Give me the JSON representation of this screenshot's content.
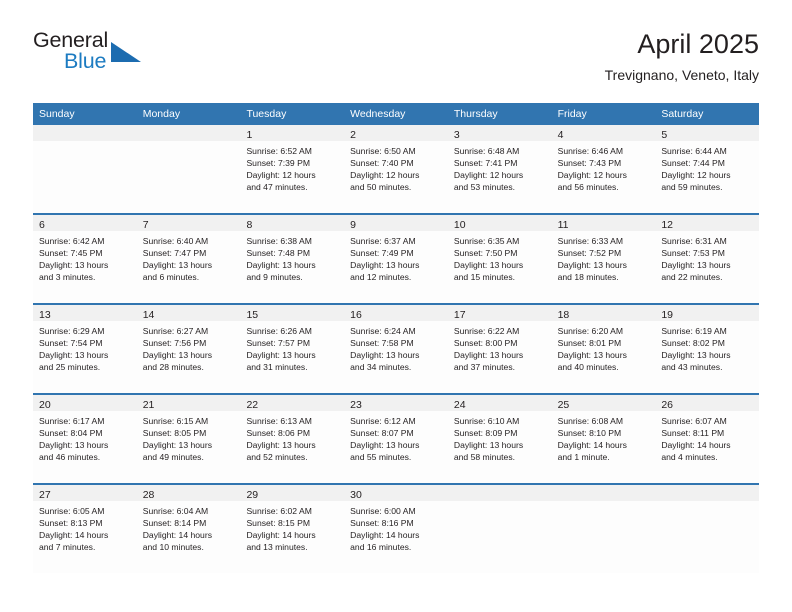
{
  "brand": {
    "name_top": "General",
    "name_bottom": "Blue",
    "triangle_icon": "triangle-icon",
    "color_text": "#231f20",
    "color_blue": "#1c7bc1",
    "color_triangle": "#1c6cb0"
  },
  "header": {
    "title": "April 2025",
    "subtitle": "Trevignano, Veneto, Italy"
  },
  "theme": {
    "header_blue": "#3175b0",
    "date_strip_grey": "#f1f1f1",
    "cell_white": "#fdfdfd",
    "text": "#231f20"
  },
  "weekdays": [
    "Sunday",
    "Monday",
    "Tuesday",
    "Wednesday",
    "Thursday",
    "Friday",
    "Saturday"
  ],
  "weeks": [
    [
      {
        "date": "",
        "empty": true,
        "sunrise": "",
        "sunset": "",
        "daylight_1": "",
        "daylight_2": ""
      },
      {
        "date": "",
        "empty": true,
        "sunrise": "",
        "sunset": "",
        "daylight_1": "",
        "daylight_2": ""
      },
      {
        "date": "1",
        "empty": false,
        "sunrise": "Sunrise: 6:52 AM",
        "sunset": "Sunset: 7:39 PM",
        "daylight_1": "Daylight: 12 hours",
        "daylight_2": "and 47 minutes."
      },
      {
        "date": "2",
        "empty": false,
        "sunrise": "Sunrise: 6:50 AM",
        "sunset": "Sunset: 7:40 PM",
        "daylight_1": "Daylight: 12 hours",
        "daylight_2": "and 50 minutes."
      },
      {
        "date": "3",
        "empty": false,
        "sunrise": "Sunrise: 6:48 AM",
        "sunset": "Sunset: 7:41 PM",
        "daylight_1": "Daylight: 12 hours",
        "daylight_2": "and 53 minutes."
      },
      {
        "date": "4",
        "empty": false,
        "sunrise": "Sunrise: 6:46 AM",
        "sunset": "Sunset: 7:43 PM",
        "daylight_1": "Daylight: 12 hours",
        "daylight_2": "and 56 minutes."
      },
      {
        "date": "5",
        "empty": false,
        "sunrise": "Sunrise: 6:44 AM",
        "sunset": "Sunset: 7:44 PM",
        "daylight_1": "Daylight: 12 hours",
        "daylight_2": "and 59 minutes."
      }
    ],
    [
      {
        "date": "6",
        "empty": false,
        "sunrise": "Sunrise: 6:42 AM",
        "sunset": "Sunset: 7:45 PM",
        "daylight_1": "Daylight: 13 hours",
        "daylight_2": "and 3 minutes."
      },
      {
        "date": "7",
        "empty": false,
        "sunrise": "Sunrise: 6:40 AM",
        "sunset": "Sunset: 7:47 PM",
        "daylight_1": "Daylight: 13 hours",
        "daylight_2": "and 6 minutes."
      },
      {
        "date": "8",
        "empty": false,
        "sunrise": "Sunrise: 6:38 AM",
        "sunset": "Sunset: 7:48 PM",
        "daylight_1": "Daylight: 13 hours",
        "daylight_2": "and 9 minutes."
      },
      {
        "date": "9",
        "empty": false,
        "sunrise": "Sunrise: 6:37 AM",
        "sunset": "Sunset: 7:49 PM",
        "daylight_1": "Daylight: 13 hours",
        "daylight_2": "and 12 minutes."
      },
      {
        "date": "10",
        "empty": false,
        "sunrise": "Sunrise: 6:35 AM",
        "sunset": "Sunset: 7:50 PM",
        "daylight_1": "Daylight: 13 hours",
        "daylight_2": "and 15 minutes."
      },
      {
        "date": "11",
        "empty": false,
        "sunrise": "Sunrise: 6:33 AM",
        "sunset": "Sunset: 7:52 PM",
        "daylight_1": "Daylight: 13 hours",
        "daylight_2": "and 18 minutes."
      },
      {
        "date": "12",
        "empty": false,
        "sunrise": "Sunrise: 6:31 AM",
        "sunset": "Sunset: 7:53 PM",
        "daylight_1": "Daylight: 13 hours",
        "daylight_2": "and 22 minutes."
      }
    ],
    [
      {
        "date": "13",
        "empty": false,
        "sunrise": "Sunrise: 6:29 AM",
        "sunset": "Sunset: 7:54 PM",
        "daylight_1": "Daylight: 13 hours",
        "daylight_2": "and 25 minutes."
      },
      {
        "date": "14",
        "empty": false,
        "sunrise": "Sunrise: 6:27 AM",
        "sunset": "Sunset: 7:56 PM",
        "daylight_1": "Daylight: 13 hours",
        "daylight_2": "and 28 minutes."
      },
      {
        "date": "15",
        "empty": false,
        "sunrise": "Sunrise: 6:26 AM",
        "sunset": "Sunset: 7:57 PM",
        "daylight_1": "Daylight: 13 hours",
        "daylight_2": "and 31 minutes."
      },
      {
        "date": "16",
        "empty": false,
        "sunrise": "Sunrise: 6:24 AM",
        "sunset": "Sunset: 7:58 PM",
        "daylight_1": "Daylight: 13 hours",
        "daylight_2": "and 34 minutes."
      },
      {
        "date": "17",
        "empty": false,
        "sunrise": "Sunrise: 6:22 AM",
        "sunset": "Sunset: 8:00 PM",
        "daylight_1": "Daylight: 13 hours",
        "daylight_2": "and 37 minutes."
      },
      {
        "date": "18",
        "empty": false,
        "sunrise": "Sunrise: 6:20 AM",
        "sunset": "Sunset: 8:01 PM",
        "daylight_1": "Daylight: 13 hours",
        "daylight_2": "and 40 minutes."
      },
      {
        "date": "19",
        "empty": false,
        "sunrise": "Sunrise: 6:19 AM",
        "sunset": "Sunset: 8:02 PM",
        "daylight_1": "Daylight: 13 hours",
        "daylight_2": "and 43 minutes."
      }
    ],
    [
      {
        "date": "20",
        "empty": false,
        "sunrise": "Sunrise: 6:17 AM",
        "sunset": "Sunset: 8:04 PM",
        "daylight_1": "Daylight: 13 hours",
        "daylight_2": "and 46 minutes."
      },
      {
        "date": "21",
        "empty": false,
        "sunrise": "Sunrise: 6:15 AM",
        "sunset": "Sunset: 8:05 PM",
        "daylight_1": "Daylight: 13 hours",
        "daylight_2": "and 49 minutes."
      },
      {
        "date": "22",
        "empty": false,
        "sunrise": "Sunrise: 6:13 AM",
        "sunset": "Sunset: 8:06 PM",
        "daylight_1": "Daylight: 13 hours",
        "daylight_2": "and 52 minutes."
      },
      {
        "date": "23",
        "empty": false,
        "sunrise": "Sunrise: 6:12 AM",
        "sunset": "Sunset: 8:07 PM",
        "daylight_1": "Daylight: 13 hours",
        "daylight_2": "and 55 minutes."
      },
      {
        "date": "24",
        "empty": false,
        "sunrise": "Sunrise: 6:10 AM",
        "sunset": "Sunset: 8:09 PM",
        "daylight_1": "Daylight: 13 hours",
        "daylight_2": "and 58 minutes."
      },
      {
        "date": "25",
        "empty": false,
        "sunrise": "Sunrise: 6:08 AM",
        "sunset": "Sunset: 8:10 PM",
        "daylight_1": "Daylight: 14 hours",
        "daylight_2": "and 1 minute."
      },
      {
        "date": "26",
        "empty": false,
        "sunrise": "Sunrise: 6:07 AM",
        "sunset": "Sunset: 8:11 PM",
        "daylight_1": "Daylight: 14 hours",
        "daylight_2": "and 4 minutes."
      }
    ],
    [
      {
        "date": "27",
        "empty": false,
        "sunrise": "Sunrise: 6:05 AM",
        "sunset": "Sunset: 8:13 PM",
        "daylight_1": "Daylight: 14 hours",
        "daylight_2": "and 7 minutes."
      },
      {
        "date": "28",
        "empty": false,
        "sunrise": "Sunrise: 6:04 AM",
        "sunset": "Sunset: 8:14 PM",
        "daylight_1": "Daylight: 14 hours",
        "daylight_2": "and 10 minutes."
      },
      {
        "date": "29",
        "empty": false,
        "sunrise": "Sunrise: 6:02 AM",
        "sunset": "Sunset: 8:15 PM",
        "daylight_1": "Daylight: 14 hours",
        "daylight_2": "and 13 minutes."
      },
      {
        "date": "30",
        "empty": false,
        "sunrise": "Sunrise: 6:00 AM",
        "sunset": "Sunset: 8:16 PM",
        "daylight_1": "Daylight: 14 hours",
        "daylight_2": "and 16 minutes."
      },
      {
        "date": "",
        "empty": true,
        "sunrise": "",
        "sunset": "",
        "daylight_1": "",
        "daylight_2": ""
      },
      {
        "date": "",
        "empty": true,
        "sunrise": "",
        "sunset": "",
        "daylight_1": "",
        "daylight_2": ""
      },
      {
        "date": "",
        "empty": true,
        "sunrise": "",
        "sunset": "",
        "daylight_1": "",
        "daylight_2": ""
      }
    ]
  ]
}
